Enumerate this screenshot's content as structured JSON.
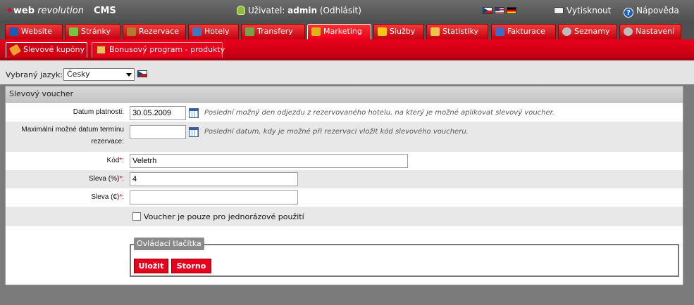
{
  "header": {
    "logo_web": "web",
    "logo_revolution": "revolution",
    "logo_cms": "CMS",
    "user_label": "Uživatel:",
    "user_name": "admin",
    "logout": "(Odhlásit)",
    "print": "Vytisknout",
    "help": "Nápověda",
    "help_glyph": "?"
  },
  "tabs": [
    {
      "label": "Website",
      "icon": "home-icon",
      "color": "#1b5bb5"
    },
    {
      "label": "Stránky",
      "icon": "puzzle-icon",
      "color": "#7cc242"
    },
    {
      "label": "Rezervace",
      "icon": "reservation-icon",
      "color": "#b67a2e"
    },
    {
      "label": "Hotely",
      "icon": "hotel-icon",
      "color": "#3b78c4"
    },
    {
      "label": "Transfery",
      "icon": "car-icon",
      "color": "#7aa04a"
    },
    {
      "label": "Marketing",
      "icon": "trophy-icon",
      "color": "#e2b21a"
    },
    {
      "label": "Služby",
      "icon": "star-icon",
      "color": "#f5c518"
    },
    {
      "label": "Statistiky",
      "icon": "chart-icon",
      "color": "#e8c64a"
    },
    {
      "label": "Fakturace",
      "icon": "invoice-icon",
      "color": "#3c6cc6"
    },
    {
      "label": "Seznamy",
      "icon": "gear-icon",
      "color": "#bdbdbd"
    },
    {
      "label": "Nastavení",
      "icon": "settings-icon",
      "color": "#bdbdbd"
    }
  ],
  "subtabs": [
    {
      "label": "Slevové kupóny",
      "icon": "coupon-icon",
      "color": "#f0a030"
    },
    {
      "label": "Bonusový program - produkty",
      "icon": "gift-icon",
      "color": "#e8c15a"
    }
  ],
  "language": {
    "label": "Vybraný jazyk:",
    "selected": "Česky"
  },
  "form": {
    "title": "Slevový voucher",
    "valid_date_label": "Datum platnosti:",
    "valid_date_value": "30.05.2009",
    "valid_date_hint": "Poslední možný den odjezdu z rezervovaného hotelu, na který je možné aplikovat slevový voucher.",
    "max_date_label_1": "Maximální možné datum termínu",
    "max_date_label_2": "rezervace:",
    "max_date_value": "",
    "max_date_hint": "Poslední datum, kdy je možné při rezervaci vložit kód slevového voucheru.",
    "code_label": "Kód",
    "code_value": "Veletrh",
    "discount_pct_label": "Sleva (%)",
    "discount_pct_value": "4",
    "discount_eur_label": "Sleva (€)",
    "discount_eur_value": "",
    "required_mark": "*:",
    "single_use_label": "Voucher je pouze pro jednorázové použití"
  },
  "controls": {
    "legend": "Ovládací tlačítka",
    "save": "Uložit",
    "cancel": "Storno"
  }
}
